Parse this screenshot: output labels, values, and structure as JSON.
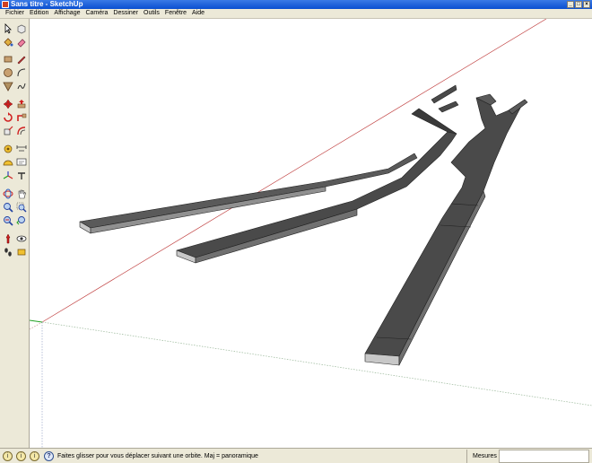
{
  "window": {
    "title": "Sans titre - SketchUp",
    "minimize_glyph": "_",
    "maximize_glyph": "□",
    "close_glyph": "×"
  },
  "menu": [
    {
      "label": "Fichier"
    },
    {
      "label": "Edition"
    },
    {
      "label": "Affichage"
    },
    {
      "label": "Caméra"
    },
    {
      "label": "Dessiner"
    },
    {
      "label": "Outils"
    },
    {
      "label": "Fenêtre"
    },
    {
      "label": "Aide"
    }
  ],
  "tools": [
    "select-icon",
    "eraser-icon",
    "paint-bucket-icon",
    "eraser-pink-icon",
    "rectangle-icon",
    "pencil-icon",
    "circle-icon",
    "arc-icon",
    "polygon-icon",
    "freehand-icon",
    "move-icon",
    "push-pull-icon",
    "rotate-icon",
    "follow-me-icon",
    "scale-icon",
    "offset-icon",
    "tape-measure-icon",
    "dimension-icon",
    "protractor-icon",
    "text-icon",
    "axes-icon",
    "3d-text-icon",
    "orbit-icon",
    "pan-icon",
    "zoom-icon",
    "zoom-window-icon",
    "zoom-extents-icon",
    "previous-view-icon",
    "position-camera-icon",
    "look-around-icon",
    "walk-icon",
    "section-plane-icon"
  ],
  "status": {
    "hint": "Faites glisser pour vous déplacer suivant une orbite.  Maj = panoramique",
    "help_glyph": "?",
    "measures_label": "Mesures",
    "measures_value": ""
  },
  "colors": {
    "title_bar": "#0a4fd0",
    "chrome": "#ece9d8",
    "model_dark": "#4a4a4a",
    "model_light": "#c8c8c8",
    "axis_red": "#c04040",
    "axis_green": "#40a040"
  }
}
